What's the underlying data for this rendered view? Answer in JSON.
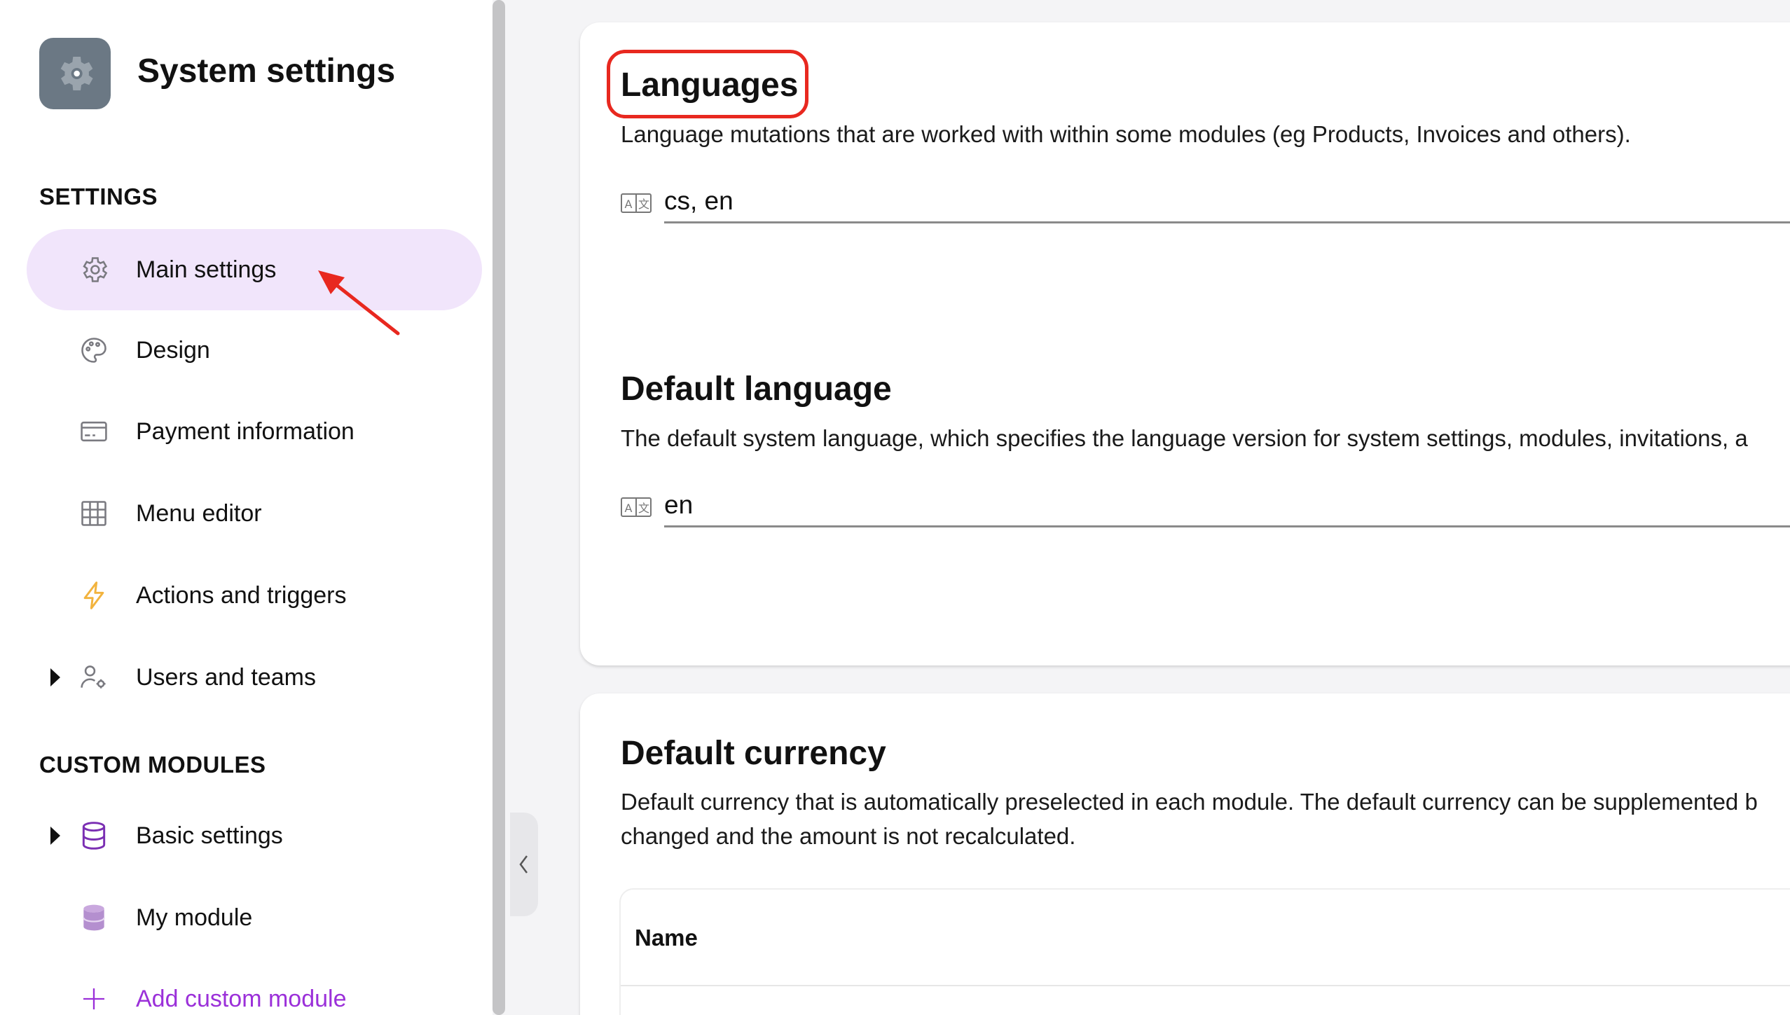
{
  "app": {
    "title": "System settings",
    "logo_icon": "gear-icon"
  },
  "sidebar": {
    "settings_heading": "SETTINGS",
    "items": [
      {
        "label": "Main settings",
        "icon": "gear-icon",
        "active": true
      },
      {
        "label": "Design",
        "icon": "palette-icon"
      },
      {
        "label": "Payment information",
        "icon": "credit-card-icon"
      },
      {
        "label": "Menu editor",
        "icon": "grid-icon"
      },
      {
        "label": "Actions and triggers",
        "icon": "lightning-icon"
      },
      {
        "label": "Users and teams",
        "icon": "users-gear-icon",
        "expandable": true
      }
    ],
    "custom_heading": "CUSTOM MODULES",
    "custom_items": [
      {
        "label": "Basic settings",
        "icon": "database-icon",
        "expandable": true
      },
      {
        "label": "My module",
        "icon": "database-filled-icon"
      },
      {
        "label": "Add custom module",
        "icon": "plus-icon"
      }
    ]
  },
  "main": {
    "languages": {
      "title": "Languages",
      "description": "Language mutations that are worked with within some modules (eg Products, Invoices and others).",
      "value": "cs, en"
    },
    "default_language": {
      "title": "Default language",
      "description": "The default system language, which specifies the language version for system settings, modules, invitations, a",
      "value": "en"
    },
    "default_currency": {
      "title": "Default currency",
      "description_line1": "Default currency that is automatically preselected in each module. The default currency can be supplemented b",
      "description_line2": "changed and the amount is not recalculated.",
      "table_header_name": "Name"
    }
  },
  "colors": {
    "accent_purple": "#9b30d9",
    "active_nav_bg": "#f1e5fb",
    "annotation_red": "#e8281f"
  }
}
